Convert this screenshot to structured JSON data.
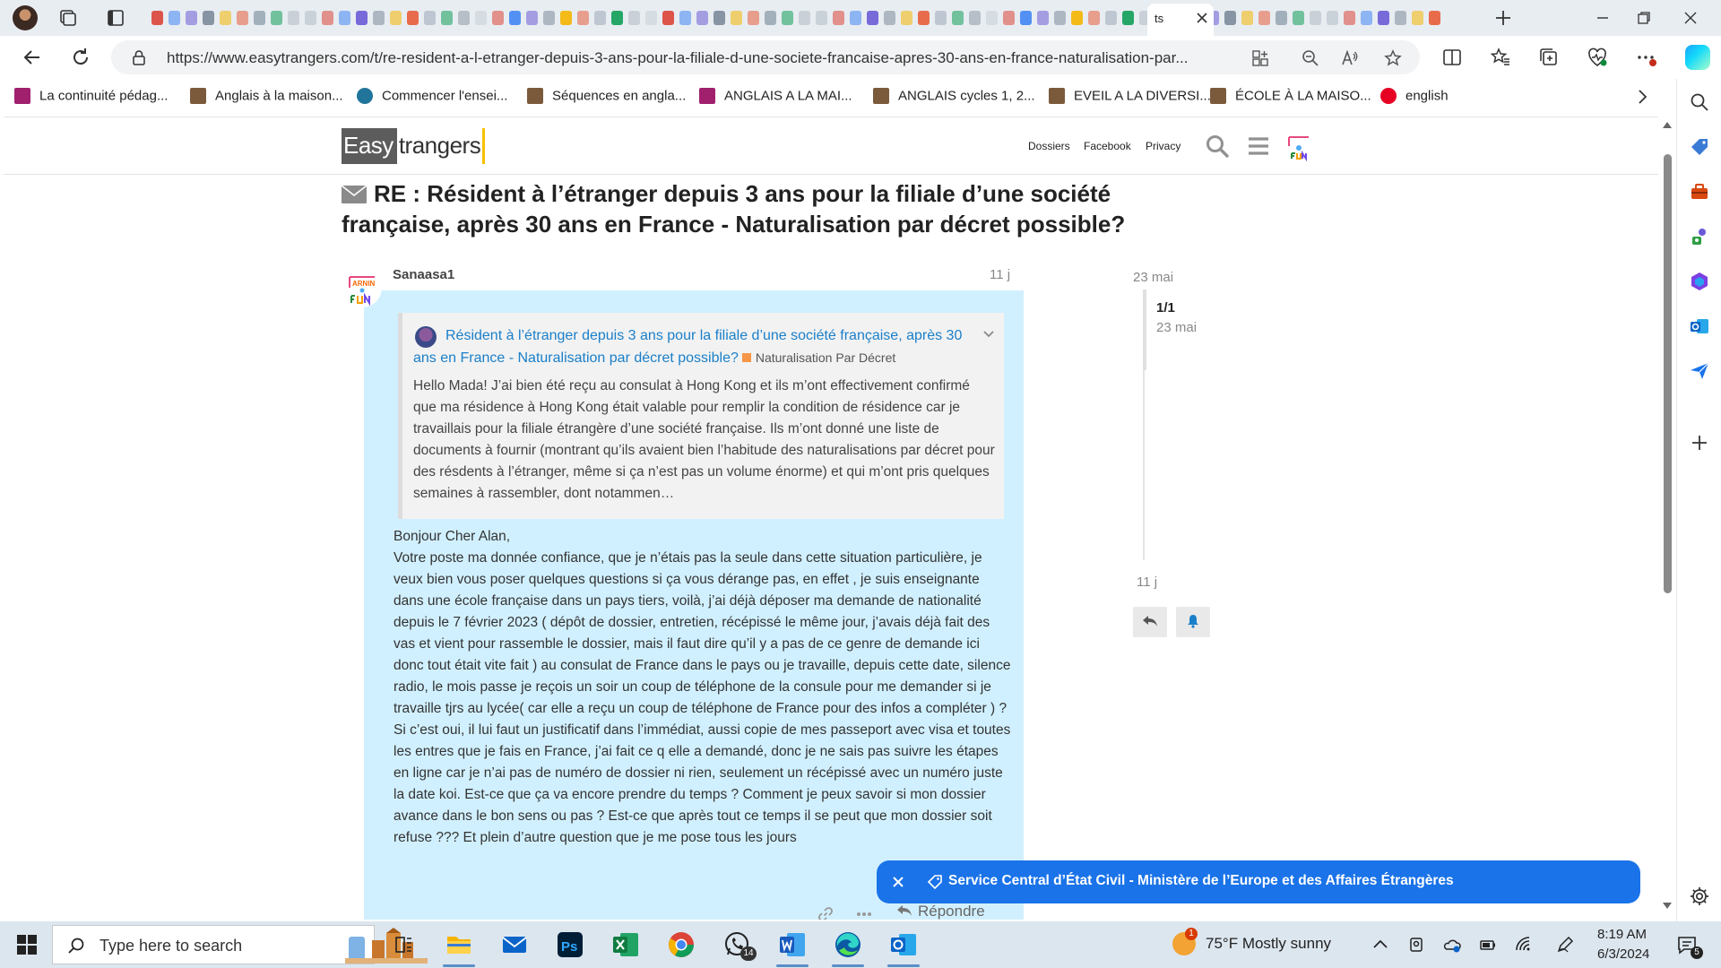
{
  "browser": {
    "active_tab_label": "ts",
    "url": "https://www.easytrangers.com/t/re-resident-a-l-etranger-depuis-3-ans-pour-la-filiale-d-une-societe-francaise-apres-30-ans-en-france-naturalisation-par...",
    "bookmarks": [
      {
        "label": "La continuité pédag...",
        "icon_color": "#a0206e"
      },
      {
        "label": "Anglais à la maison...",
        "icon_color": "#7b5a3c"
      },
      {
        "label": "Commencer l'ensei...",
        "icon_color": "#21759b"
      },
      {
        "label": "Séquences en angla...",
        "icon_color": "#7b5a3c"
      },
      {
        "label": "ANGLAIS A LA MAI...",
        "icon_color": "#a0206e"
      },
      {
        "label": "ANGLAIS cycles 1, 2...",
        "icon_color": "#7b5a3c"
      },
      {
        "label": "EVEIL A LA DIVERSI...",
        "icon_color": "#7b5a3c"
      },
      {
        "label": "ÉCOLE À LA MAISO...",
        "icon_color": "#7b5a3c"
      },
      {
        "label": "english",
        "icon_color": "#e60023"
      }
    ]
  },
  "site": {
    "logo_left": "Easy",
    "logo_right": "trangers",
    "nav": [
      "Dossiers",
      "Facebook",
      "Privacy"
    ]
  },
  "topic": {
    "title": "RE : Résident à l’étranger depuis 3 ans pour la filiale d’une société française, après 30 ans en France - Naturalisation par décret possible?"
  },
  "post": {
    "author": "Sanaasa1",
    "date": "11 j",
    "quote": {
      "title": "Résident à l’étranger depuis 3 ans pour la filiale d’une société française, après 30 ans en France - Naturalisation par décret possible?",
      "category": "Naturalisation Par Décret",
      "text": "Hello Mada! J’ai bien été reçu au consulat à Hong Kong et ils m’ont effectivement confirmé que ma résidence à Hong Kong était valable pour remplir la condition de résidence car je travaillais pour la filiale étrangère d’une société française. Ils m’ont donné une liste de documents à fournir (montrant qu’ils avaient bien l’habitude des naturalisations par décret pour des résdents à l’étranger, même si ça n’est pas un volume énorme) et qui m’ont pris quelques semaines à rassembler, dont notammen…"
    },
    "greeting": "Bonjour Cher Alan,",
    "body": "Votre poste ma donnée confiance, que je n’étais pas la seule dans cette situation particulière, je veux bien vous poser quelques questions si ça vous dérange pas, en effet , je suis enseignante dans une école française dans un pays tiers, voilà, j’ai déjà déposer ma demande de nationalité depuis le 7 février 2023 ( dépôt de dossier, entretien, récépissé le même jour, j’avais déjà fait des vas et vient pour rassemble le dossier, mais il faut dire qu’il y a pas de ce genre de demande ici donc tout était vite fait ) au consulat de France dans le pays ou je travaille, depuis cette date, silence radio, le mois passe je reçois un soir un coup de téléphone de la consule pour me demander si je travaille tjrs au lycée( car elle a reçu un coup de téléphone de France pour des infos a compléter ) ? Si c’est oui, il lui faut un justificatif dans l’immédiat, aussi copie de mes passeport avec visa et toutes les entres que je fais en France, j’ai fait ce q elle a demandé, donc je ne sais pas suivre les étapes en ligne car je n’ai pas de numéro de dossier ni rien, seulement un récépissé avec un numéro juste la date koi. Est-ce que ça va encore prendre du temps ? Comment je peux savoir si mon dossier avance dans le bon sens ou pas ? Est-ce que après tout ce temps il se peut que mon dossier soit refuse ??? Et plein d’autre question que je me pose tous les jours",
    "reply_label": "Répondre"
  },
  "timeline": {
    "top_date": "23 mai",
    "count": "1/1",
    "count_date": "23 mai",
    "bottom_date": "11 j"
  },
  "toast": {
    "text": "Service Central d’État Civil - Ministère de l’Europe et des Affaires Étrangères"
  },
  "taskbar": {
    "search_placeholder": "Type here to search",
    "whatsapp_badge": "14",
    "weather_badge": "1",
    "weather": "75°F  Mostly sunny",
    "time": "8:19 AM",
    "date": "6/3/2024",
    "notifications": "5"
  },
  "colors": {
    "accent": "#1a73e8",
    "link": "#1a7fc9",
    "post_highlight": "#d1f0ff",
    "category": "#f79646",
    "logo_underline": "#f6c000"
  }
}
